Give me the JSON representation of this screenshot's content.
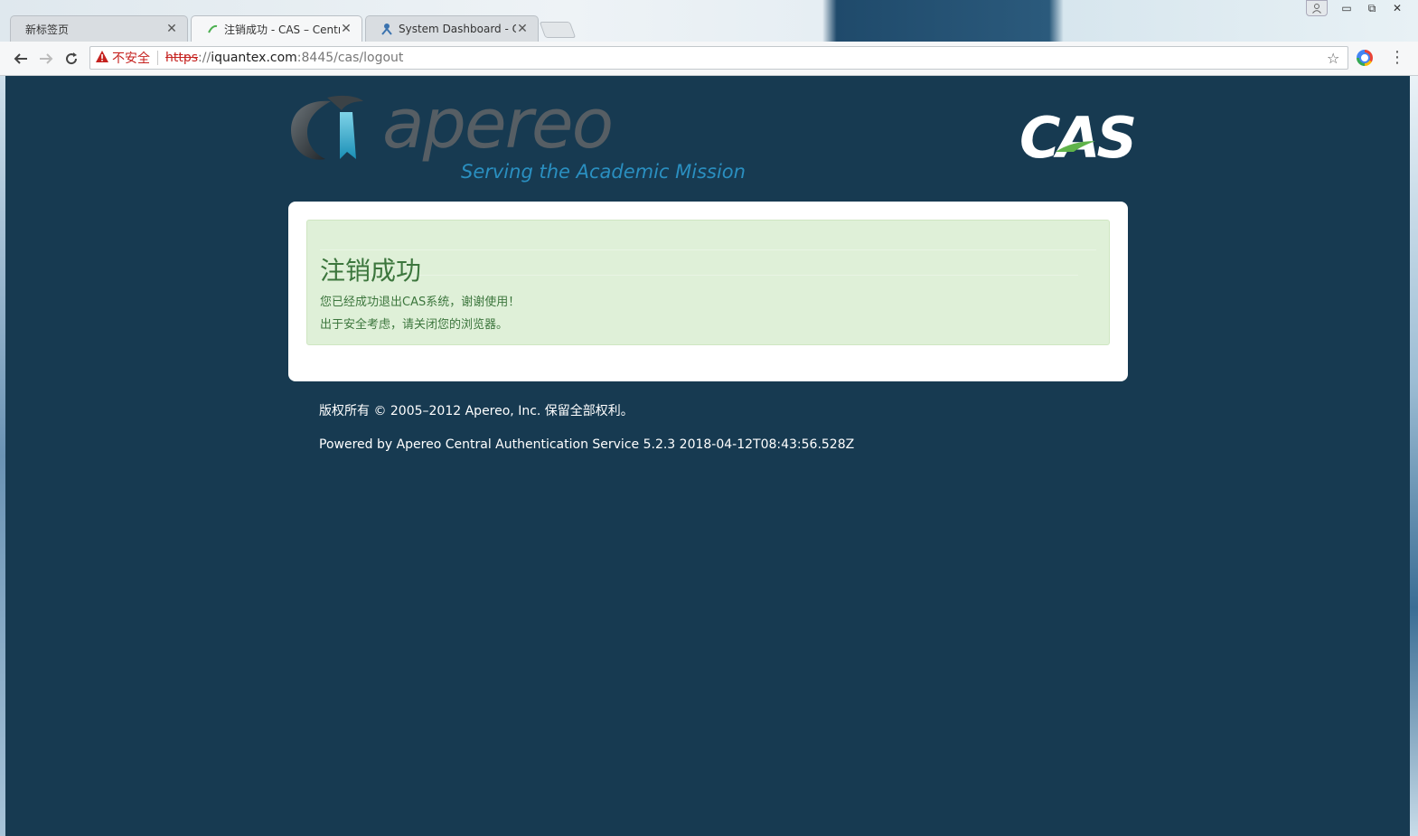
{
  "tabs": [
    {
      "title": "新标签页",
      "active": false
    },
    {
      "title": "注销成功 - CAS – Centr",
      "active": true
    },
    {
      "title": "System Dashboard - C",
      "active": false
    }
  ],
  "address": {
    "security_label": "不安全",
    "scheme": "https",
    "separator": "://",
    "host": "iquantex.com",
    "rest": ":8445/cas/logout"
  },
  "header": {
    "apereo_wordmark": "apereo",
    "apereo_tagline": "Serving the Academic Mission",
    "cas_logo": "CAS"
  },
  "message": {
    "title": "注销成功",
    "line1": "您已经成功退出CAS系统，谢谢使用！",
    "line2": "出于安全考虑，请关闭您的浏览器。"
  },
  "footer": {
    "copyright": "版权所有 © 2005–2012 Apereo, Inc. 保留全部权利。",
    "powered_by": "Powered by Apereo Central Authentication Service 5.2.3 2018-04-12T08:43:56.528Z"
  },
  "colors": {
    "page_background": "#173a51",
    "success_background": "#dff0d8",
    "success_text": "#3c763d",
    "insecure_red": "#c5221f"
  },
  "icons": {
    "back": "arrow-left-icon",
    "forward": "arrow-right-icon",
    "reload": "reload-icon",
    "warning": "warning-triangle-icon",
    "bookmark": "star-icon",
    "extension": "chrome-extension-icon",
    "menu": "kebab-menu-icon"
  }
}
